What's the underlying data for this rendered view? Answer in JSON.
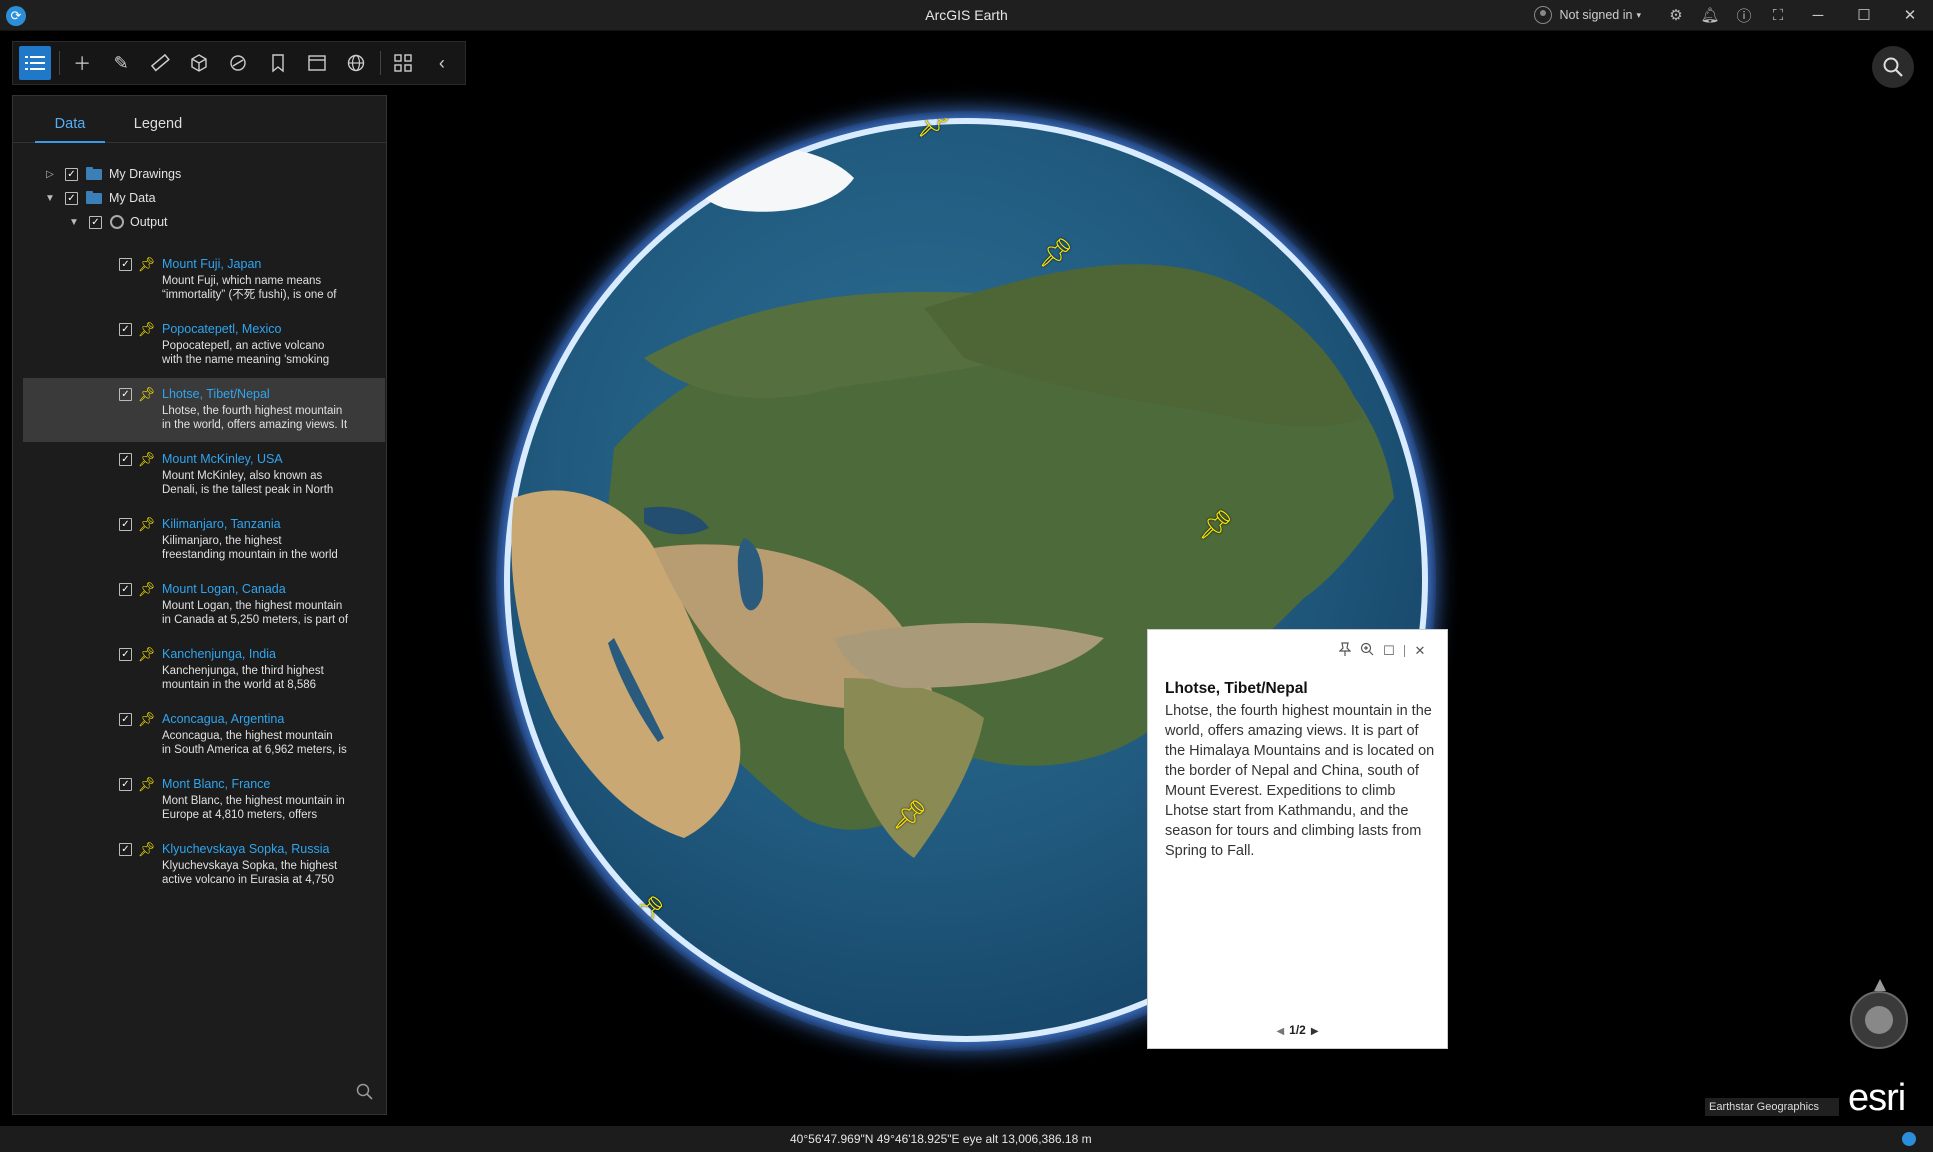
{
  "window": {
    "title": "ArcGIS Earth",
    "signin_label": "Not signed in",
    "icons": [
      "settings-icon",
      "notifications-icon",
      "info-icon",
      "fullscreen-icon"
    ],
    "controls": [
      "minimize",
      "maximize",
      "close"
    ]
  },
  "toolbar": {
    "tools": [
      "layers-list",
      "add",
      "draw",
      "measure",
      "3d-analysis",
      "interactive-analysis",
      "bookmarks",
      "presentation",
      "map-settings",
      "widgets",
      "collapse"
    ]
  },
  "panel": {
    "tabs": [
      {
        "label": "Data",
        "active": true
      },
      {
        "label": "Legend",
        "active": false
      }
    ],
    "tree": {
      "my_drawings": "My Drawings",
      "my_data": "My Data",
      "output": "Output"
    },
    "items": [
      {
        "title": "Mount Fuji, Japan",
        "desc1": "Mount Fuji, which name means",
        "desc2": "“immortality” (不死 fushi), is one of"
      },
      {
        "title": "Popocatepetl, Mexico",
        "desc1": "Popocatepetl, an active volcano",
        "desc2": "with the name meaning 'smoking"
      },
      {
        "title": "Lhotse, Tibet/Nepal",
        "desc1": "Lhotse, the fourth highest mountain",
        "desc2": "in the world, offers amazing views. It"
      },
      {
        "title": "Mount McKinley, USA",
        "desc1": "Mount McKinley, also known as",
        "desc2": "Denali, is the tallest peak in North"
      },
      {
        "title": "Kilimanjaro, Tanzania",
        "desc1": "Kilimanjaro, the highest",
        "desc2": "freestanding mountain in the world"
      },
      {
        "title": "Mount Logan, Canada",
        "desc1": "Mount Logan, the highest mountain",
        "desc2": "in Canada at 5,250 meters, is part of"
      },
      {
        "title": "Kanchenjunga, India",
        "desc1": "Kanchenjunga, the third highest",
        "desc2": "mountain in the world at 8,586"
      },
      {
        "title": "Aconcagua, Argentina",
        "desc1": "Aconcagua, the highest mountain",
        "desc2": "in South America at 6,962 meters, is"
      },
      {
        "title": "Mont Blanc, France",
        "desc1": "Mont Blanc, the highest mountain in",
        "desc2": "Europe at 4,810 meters, offers"
      },
      {
        "title": "Klyuchevskaya Sopka, Russia",
        "desc1": "Klyuchevskaya Sopka, the highest",
        "desc2": "active volcano in Eurasia at 4,750"
      }
    ]
  },
  "popup": {
    "title": "Lhotse, Tibet/Nepal",
    "text": "Lhotse, the fourth highest mountain in the world, offers amazing views. It is part of the Himalaya Mountains and is located on the border of Nepal and China, south of Mount Everest. Expeditions to climb Lhotse start from Kathmandu, and the season for tours and climbing lasts from Spring to Fall.",
    "pager": "1/2"
  },
  "map": {
    "attribution": "Earthstar Geographics",
    "logo": "esri",
    "status": "40°56'47.969\"N 49°46'18.925\"E   eye alt 13,006,386.18 m"
  },
  "colors": {
    "accent": "#1f78c8",
    "link": "#2fa5ef",
    "pin": "#f5e300",
    "panel_bg": "#1c1c1c"
  }
}
